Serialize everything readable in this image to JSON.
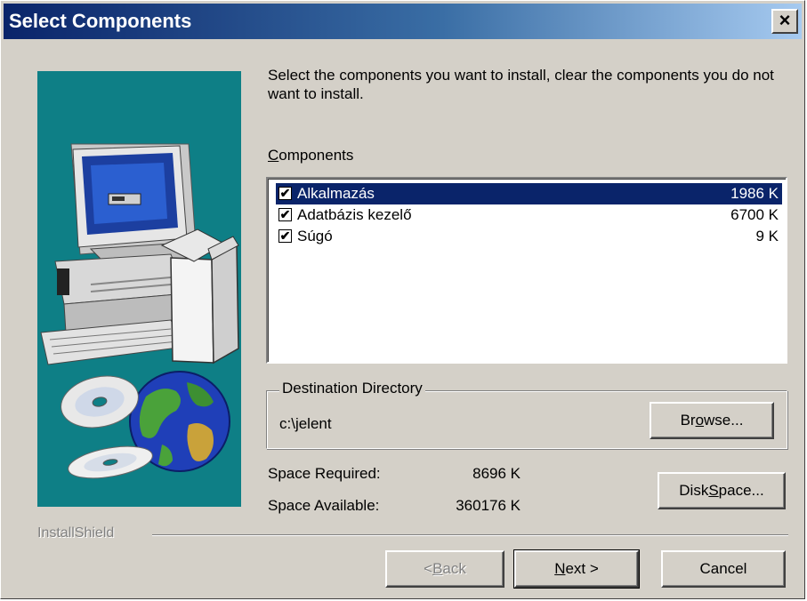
{
  "window": {
    "title": "Select Components",
    "close_glyph": "×"
  },
  "instructions": "Select the components you want to install, clear the components you do not want to install.",
  "components": {
    "label_u": "C",
    "label_rest": "omponents",
    "items": [
      {
        "name": "Alkalmazás",
        "size": "1986 K",
        "checked": true,
        "selected": true
      },
      {
        "name": "Adatbázis kezelő",
        "size": "6700 K",
        "checked": true,
        "selected": false
      },
      {
        "name": "Súgó",
        "size": "9 K",
        "checked": true,
        "selected": false
      }
    ]
  },
  "destination": {
    "group_label": "Destination Directory",
    "path": "c:\\jelent",
    "browse_pre": "Br",
    "browse_u": "o",
    "browse_post": "wse..."
  },
  "space": {
    "required_label": "Space Required:",
    "required_value": "8696 K",
    "available_label": "Space Available:",
    "available_value": "360176 K",
    "disk_pre": "Disk ",
    "disk_u": "S",
    "disk_post": "pace..."
  },
  "brand": "InstallShield",
  "buttons": {
    "back_pre": "< ",
    "back_u": "B",
    "back_post": "ack",
    "next_u": "N",
    "next_post": "ext >",
    "cancel": "Cancel"
  },
  "colors": {
    "title_start": "#0a246a",
    "title_end": "#a6caf0",
    "art_bg": "#0e7f86",
    "face": "#d4d0c8",
    "selection": "#0a246a"
  },
  "icons": [
    "close-icon",
    "checkbox-checked-icon",
    "computer-illustration",
    "cd-disc-icon",
    "globe-icon"
  ]
}
